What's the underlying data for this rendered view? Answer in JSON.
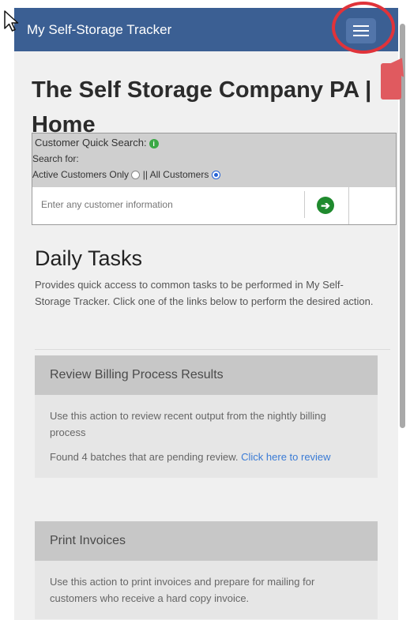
{
  "navbar": {
    "brand": "My Self-Storage Tracker",
    "menu_icon": "hamburger-icon"
  },
  "page": {
    "title": "The Self Storage Company PA | Home"
  },
  "quick_search": {
    "title": "Customer Quick Search:",
    "search_for_label": "Search for:",
    "option_active": "Active Customers Only",
    "separator": "||",
    "option_all": "All Customers",
    "selected_option": "All Customers",
    "placeholder": "Enter any customer information"
  },
  "daily_tasks": {
    "title": "Daily Tasks",
    "description": "Provides quick access to common tasks to be performed in My Self-Storage Tracker. Click one of the links below to perform the desired action."
  },
  "cards": [
    {
      "title": "Review Billing Process Results",
      "body": "Use this action to review recent output from the nightly billing process",
      "status_text": "Found 4 batches that are pending review.",
      "link_text": "Click here to review"
    },
    {
      "title": "Print Invoices",
      "body": "Use this action to print invoices and prepare for mailing for customers who receive a hard copy invoice."
    }
  ],
  "colors": {
    "navbar": "#3b5f93",
    "annotation": "#e0333a",
    "link": "#3a7bd5",
    "go_button": "#1f8a2e"
  }
}
